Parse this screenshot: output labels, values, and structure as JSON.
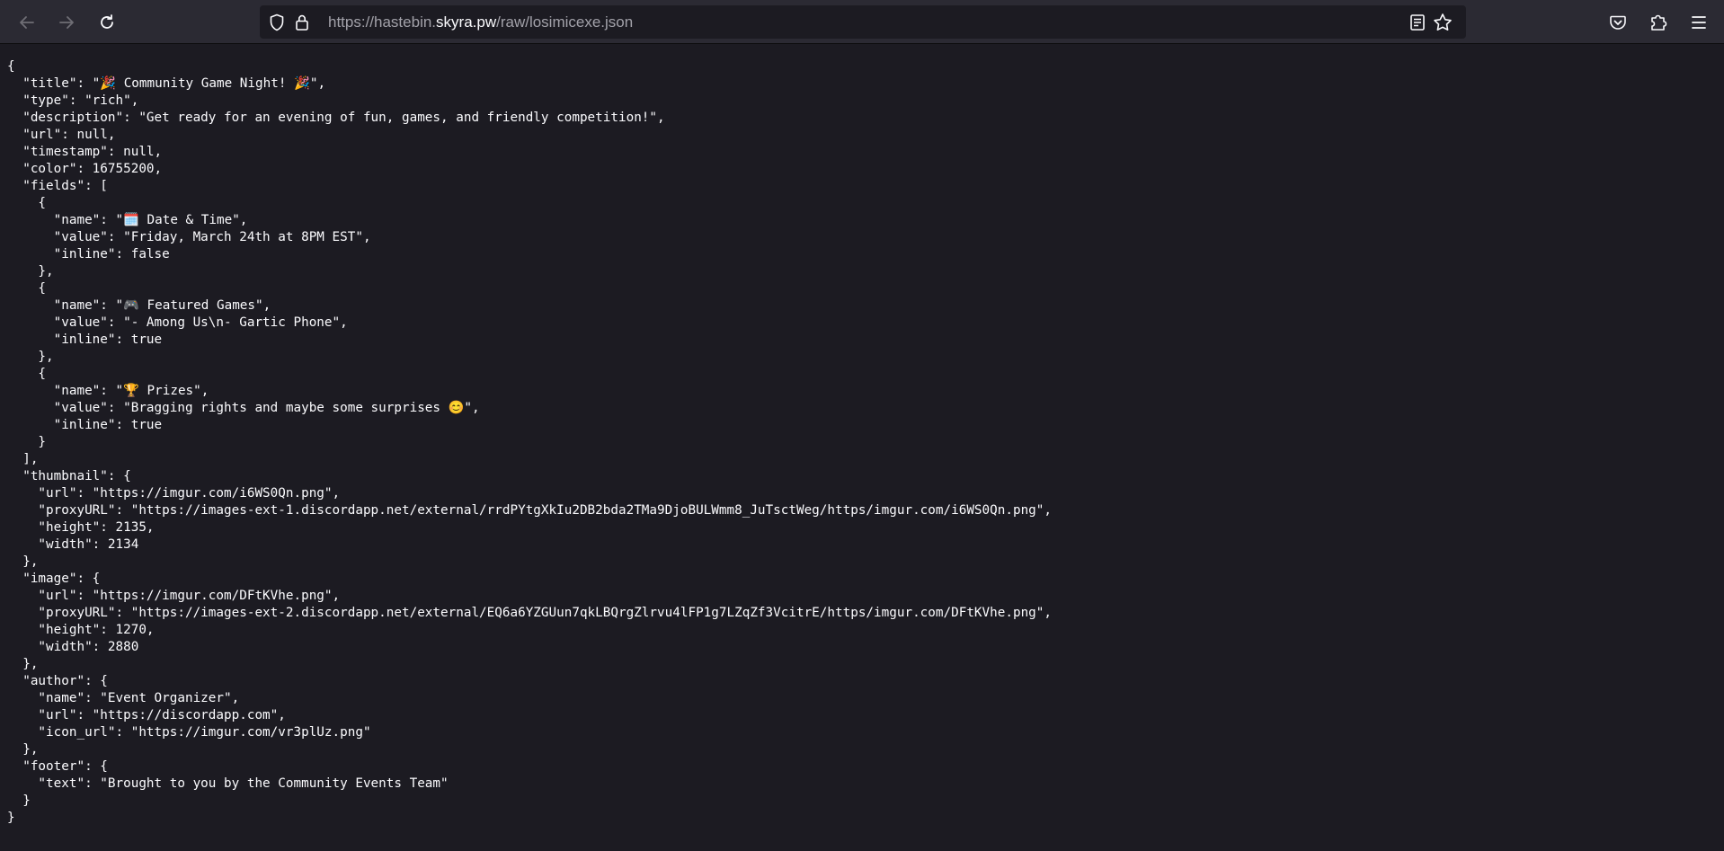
{
  "browser": {
    "url_prefix": "https://hastebin.",
    "url_host": "skyra.pw",
    "url_path": "/raw/losimicexe.json",
    "icons": {
      "back": "back-arrow-icon",
      "forward": "forward-arrow-icon",
      "reload": "reload-icon",
      "tracking": "shield-icon",
      "security": "lock-icon",
      "reader": "reader-view-icon",
      "bookmark": "star-icon",
      "pocket": "pocket-icon",
      "extensions": "puzzle-icon",
      "menu": "hamburger-menu-icon"
    }
  },
  "document": {
    "lines": [
      "{",
      "  \"title\": \"🎉 Community Game Night! 🎉\",",
      "  \"type\": \"rich\",",
      "  \"description\": \"Get ready for an evening of fun, games, and friendly competition!\",",
      "  \"url\": null,",
      "  \"timestamp\": null,",
      "  \"color\": 16755200,",
      "  \"fields\": [",
      "    {",
      "      \"name\": \"🗓️ Date & Time\",",
      "      \"value\": \"Friday, March 24th at 8PM EST\",",
      "      \"inline\": false",
      "    },",
      "    {",
      "      \"name\": \"🎮 Featured Games\",",
      "      \"value\": \"- Among Us\\n- Gartic Phone\",",
      "      \"inline\": true",
      "    },",
      "    {",
      "      \"name\": \"🏆 Prizes\",",
      "      \"value\": \"Bragging rights and maybe some surprises 😊\",",
      "      \"inline\": true",
      "    }",
      "  ],",
      "  \"thumbnail\": {",
      "    \"url\": \"https://imgur.com/i6WS0Qn.png\",",
      "    \"proxyURL\": \"https://images-ext-1.discordapp.net/external/rrdPYtgXkIu2DB2bda2TMa9DjoBULWmm8_JuTsctWeg/https/imgur.com/i6WS0Qn.png\",",
      "    \"height\": 2135,",
      "    \"width\": 2134",
      "  },",
      "  \"image\": {",
      "    \"url\": \"https://imgur.com/DFtKVhe.png\",",
      "    \"proxyURL\": \"https://images-ext-2.discordapp.net/external/EQ6a6YZGUun7qkLBQrgZlrvu4lFP1g7LZqZf3VcitrE/https/imgur.com/DFtKVhe.png\",",
      "    \"height\": 1270,",
      "    \"width\": 2880",
      "  },",
      "  \"author\": {",
      "    \"name\": \"Event Organizer\",",
      "    \"url\": \"https://discordapp.com\",",
      "    \"icon_url\": \"https://imgur.com/vr3plUz.png\"",
      "  },",
      "  \"footer\": {",
      "    \"text\": \"Brought to you by the Community Events Team\"",
      "  }",
      "}"
    ]
  }
}
